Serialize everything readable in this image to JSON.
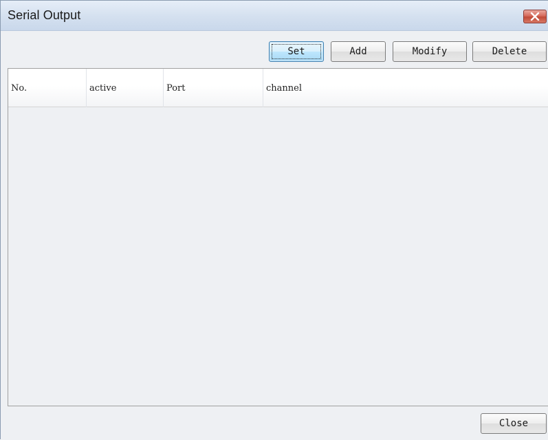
{
  "window": {
    "title": "Serial Output"
  },
  "toolbar": {
    "set_label": "Set",
    "add_label": "Add",
    "modify_label": "Modify",
    "delete_label": "Delete"
  },
  "list": {
    "columns": [
      "No.",
      "active",
      "Port",
      "channel"
    ],
    "rows": []
  },
  "footer": {
    "close_label": "Close"
  },
  "icons": {
    "title_close": "close-icon"
  },
  "colors": {
    "close_button": "#d05a48",
    "focus_button": "#bee6fd"
  }
}
